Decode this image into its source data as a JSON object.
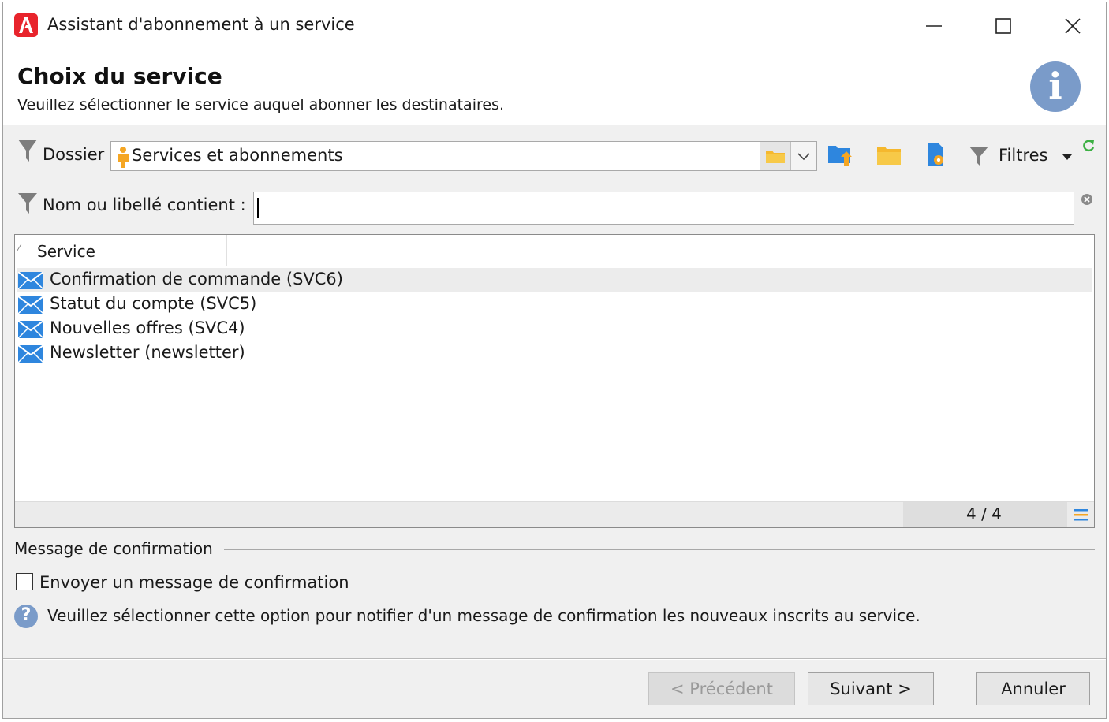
{
  "window": {
    "title": "Assistant d'abonnement à un service"
  },
  "header": {
    "title": "Choix du service",
    "subtitle": "Veuillez sélectionner le service auquel abonner les destinataires."
  },
  "filters": {
    "folder_label": "Dossier :",
    "folder_value": "Services et abonnements",
    "filters_label": "Filtres",
    "name_label": "Nom ou libellé contient :",
    "name_value": ""
  },
  "list": {
    "column_header": "Service",
    "rows": [
      {
        "label": "Confirmation de commande (SVC6)",
        "selected": true
      },
      {
        "label": "Statut du compte (SVC5)",
        "selected": false
      },
      {
        "label": "Nouvelles offres (SVC4)",
        "selected": false
      },
      {
        "label": "Newsletter (newsletter)",
        "selected": false
      }
    ],
    "count": "4 / 4"
  },
  "confirmation": {
    "section_title": "Message de confirmation",
    "checkbox_label": "Envoyer un message de confirmation",
    "checked": false,
    "help_text": "Veuillez sélectionner cette option pour notifier d'un message de confirmation les nouveaux inscrits au service."
  },
  "buttons": {
    "previous": "< Précédent",
    "next": "Suivant >",
    "cancel": "Annuler"
  },
  "colors": {
    "accent": "#e8242c",
    "info_blue": "#7a9bc9",
    "folder_orange": "#f5a623",
    "envelope_blue": "#2e86de"
  },
  "icons": {
    "app": "adobe-logo-icon",
    "info": "info-icon",
    "folder": "folder-icon",
    "envelope": "envelope-icon",
    "filter": "funnel-icon"
  }
}
